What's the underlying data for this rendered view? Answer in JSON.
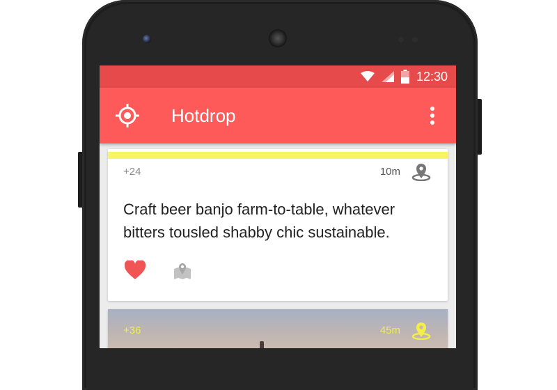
{
  "status_bar": {
    "time": "12:30"
  },
  "app_bar": {
    "title": "Hotdrop",
    "left_icon": "target-icon",
    "right_icon": "more-vert-icon",
    "color": "#ff5a5a",
    "status_color": "#e64a4a"
  },
  "feed": {
    "cards": [
      {
        "votes": "+24",
        "time": "10m",
        "text": "Craft beer banjo farm-to-table, whatever bitters tousled shabby chic sustainable.",
        "stripe_color": "#f7f560",
        "liked": true
      },
      {
        "votes": "+36",
        "time": "45m"
      }
    ]
  }
}
